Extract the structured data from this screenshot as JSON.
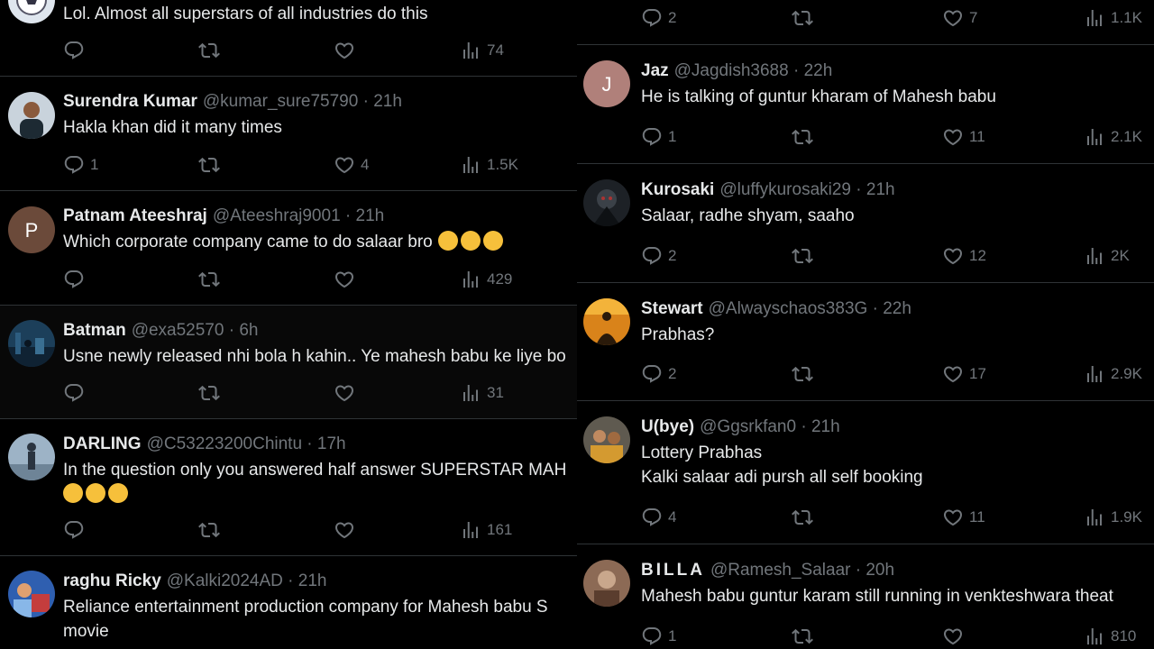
{
  "left_column": [
    {
      "name": "",
      "handle": "",
      "time": "",
      "lines": [
        "Lol. Almost all superstars of all industries do this"
      ],
      "emoji": 0,
      "replies": "",
      "reposts": "",
      "likes": "",
      "views": "74",
      "avatar": "soccer-ball"
    },
    {
      "name": "Surendra Kumar",
      "handle": "@kumar_sure75790",
      "time": "21h",
      "lines": [
        "Hakla khan did it many times"
      ],
      "emoji": 0,
      "replies": "1",
      "reposts": "",
      "likes": "4",
      "views": "1.5K",
      "avatar": "photo-man"
    },
    {
      "name": "Patnam Ateeshraj",
      "handle": "@Ateeshraj9001",
      "time": "21h",
      "lines": [
        "Which corporate company came to do salaar bro"
      ],
      "emoji": 3,
      "emoji_style": "laugh-rolling",
      "replies": "",
      "reposts": "",
      "likes": "",
      "views": "429",
      "avatar": "letter",
      "avatar_letter": "P",
      "avatar_color": "#6b4a3a"
    },
    {
      "name": "Batman",
      "handle": "@exa52570",
      "time": "6h",
      "lines": [
        "Usne newly released nhi bola h kahin.. Ye mahesh babu ke liye bo"
      ],
      "emoji": 0,
      "replies": "",
      "reposts": "",
      "likes": "",
      "views": "31",
      "avatar": "photo-city",
      "highlight": true
    },
    {
      "name": "DARLING",
      "handle": "@C53223200Chintu",
      "time": "17h",
      "lines": [
        "In the question only you answered half answer SUPERSTAR MAH"
      ],
      "emoji": 3,
      "emoji_style": "grin-sweat",
      "replies": "",
      "reposts": "",
      "likes": "",
      "views": "161",
      "avatar": "photo-figure"
    },
    {
      "name": "raghu Ricky",
      "handle": "@Kalki2024AD",
      "time": "21h",
      "lines": [
        "Reliance entertainment  production company for  Mahesh babu S",
        "movie"
      ],
      "emoji": 0,
      "replies": "",
      "reposts": "",
      "likes": "",
      "views": "",
      "avatar": "photo-blue"
    }
  ],
  "right_column": [
    {
      "name": "",
      "handle": "",
      "time": "",
      "lines": [],
      "emoji": 0,
      "replies": "2",
      "reposts": "",
      "likes": "7",
      "views": "1.1K",
      "avatar": "none"
    },
    {
      "name": "Jaz",
      "handle": "@Jagdish3688",
      "time": "22h",
      "lines": [
        "He is talking of guntur kharam of Mahesh babu"
      ],
      "emoji": 0,
      "replies": "1",
      "reposts": "",
      "likes": "11",
      "views": "2.1K",
      "avatar": "letter",
      "avatar_letter": "J",
      "avatar_color": "#b0807a"
    },
    {
      "name": "Kurosaki",
      "handle": "@luffykurosaki29",
      "time": "21h",
      "lines": [
        "Salaar, radhe shyam, saaho"
      ],
      "emoji": 0,
      "replies": "2",
      "reposts": "",
      "likes": "12",
      "views": "2K",
      "avatar": "photo-dark"
    },
    {
      "name": "Stewart",
      "handle": "@Alwayschaos383G",
      "time": "22h",
      "lines": [
        "Prabhas?"
      ],
      "emoji": 0,
      "replies": "2",
      "reposts": "",
      "likes": "17",
      "views": "2.9K",
      "avatar": "photo-sunset"
    },
    {
      "name": "U(bye)",
      "handle": "@Ggsrkfan0",
      "time": "21h",
      "lines": [
        "Lottery Prabhas",
        "Kalki salaar adi pursh all self booking"
      ],
      "emoji": 0,
      "replies": "4",
      "reposts": "",
      "likes": "11",
      "views": "1.9K",
      "avatar": "photo-group"
    },
    {
      "name": "BILLA",
      "handle": "@Ramesh_Salaar",
      "time": "20h",
      "lines": [
        "Mahesh babu guntur karam still running in venkteshwara theat"
      ],
      "emoji": 0,
      "replies": "1",
      "reposts": "",
      "likes": "",
      "views": "810",
      "avatar": "photo-brown",
      "spaced_name": true
    }
  ],
  "colors": {
    "text": "#e7e9ea",
    "muted": "#71767b",
    "divider": "#2f3336",
    "background": "#000000"
  }
}
